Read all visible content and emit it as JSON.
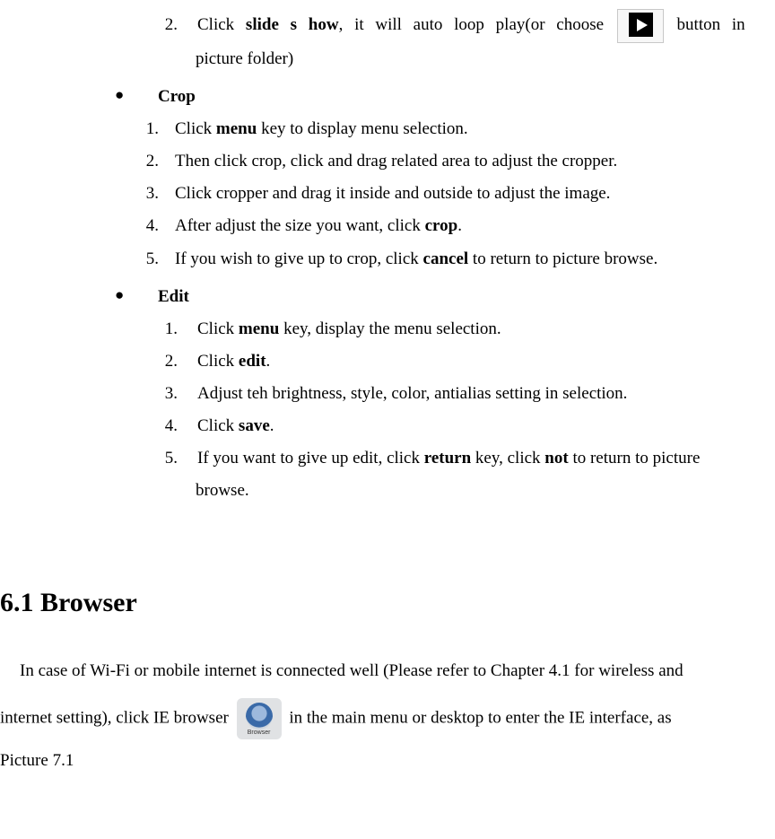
{
  "slideshow_item": {
    "num": "2.",
    "pre": "Click ",
    "bold": "slide s how",
    "mid1": ", it will auto loop play(or choose ",
    "mid2": " button in",
    "line2": "picture folder)"
  },
  "crop": {
    "title": "Crop",
    "items": [
      {
        "num": "1.",
        "pre": "Click ",
        "bold": "menu",
        "post": " key to display menu selection."
      },
      {
        "num": "2.",
        "text": "Then click crop, click and drag related area to adjust the cropper."
      },
      {
        "num": "3.",
        "text": "Click cropper and drag it inside and outside to adjust the image."
      },
      {
        "num": "4.",
        "pre": "After adjust the size you want, click ",
        "bold": "crop",
        "post": "."
      },
      {
        "num": "5.",
        "pre": "If you wish to give up to crop, click ",
        "bold": "cancel",
        "post": " to return to picture browse."
      }
    ]
  },
  "edit": {
    "title": "Edit",
    "items": [
      {
        "num": "1.",
        "pre": "Click ",
        "bold": "menu",
        "post": " key, display the menu selection."
      },
      {
        "num": "2.",
        "pre": "Click ",
        "bold": "edit",
        "post": "."
      },
      {
        "num": "3.",
        "text": "Adjust teh brightness, style, color, antialias setting in selection."
      },
      {
        "num": "4.",
        "pre": "Click ",
        "bold": "save",
        "post": "."
      },
      {
        "num": "5.",
        "pre": "If you want to give up edit, click ",
        "bold": "return",
        "mid": " key, click ",
        "bold2": "not",
        "post": " to return to picture",
        "line2": "browse."
      }
    ]
  },
  "browser": {
    "heading": "6.1 Browser",
    "p1a": "In case of Wi-Fi or mobile internet is connected well (Please refer to Chapter 4.1 for wireless and",
    "p1b_pre": "internet setting), click IE browser ",
    "p1b_post": " in the main menu or desktop to enter the IE interface, as",
    "p1c": "Picture 7.1"
  }
}
